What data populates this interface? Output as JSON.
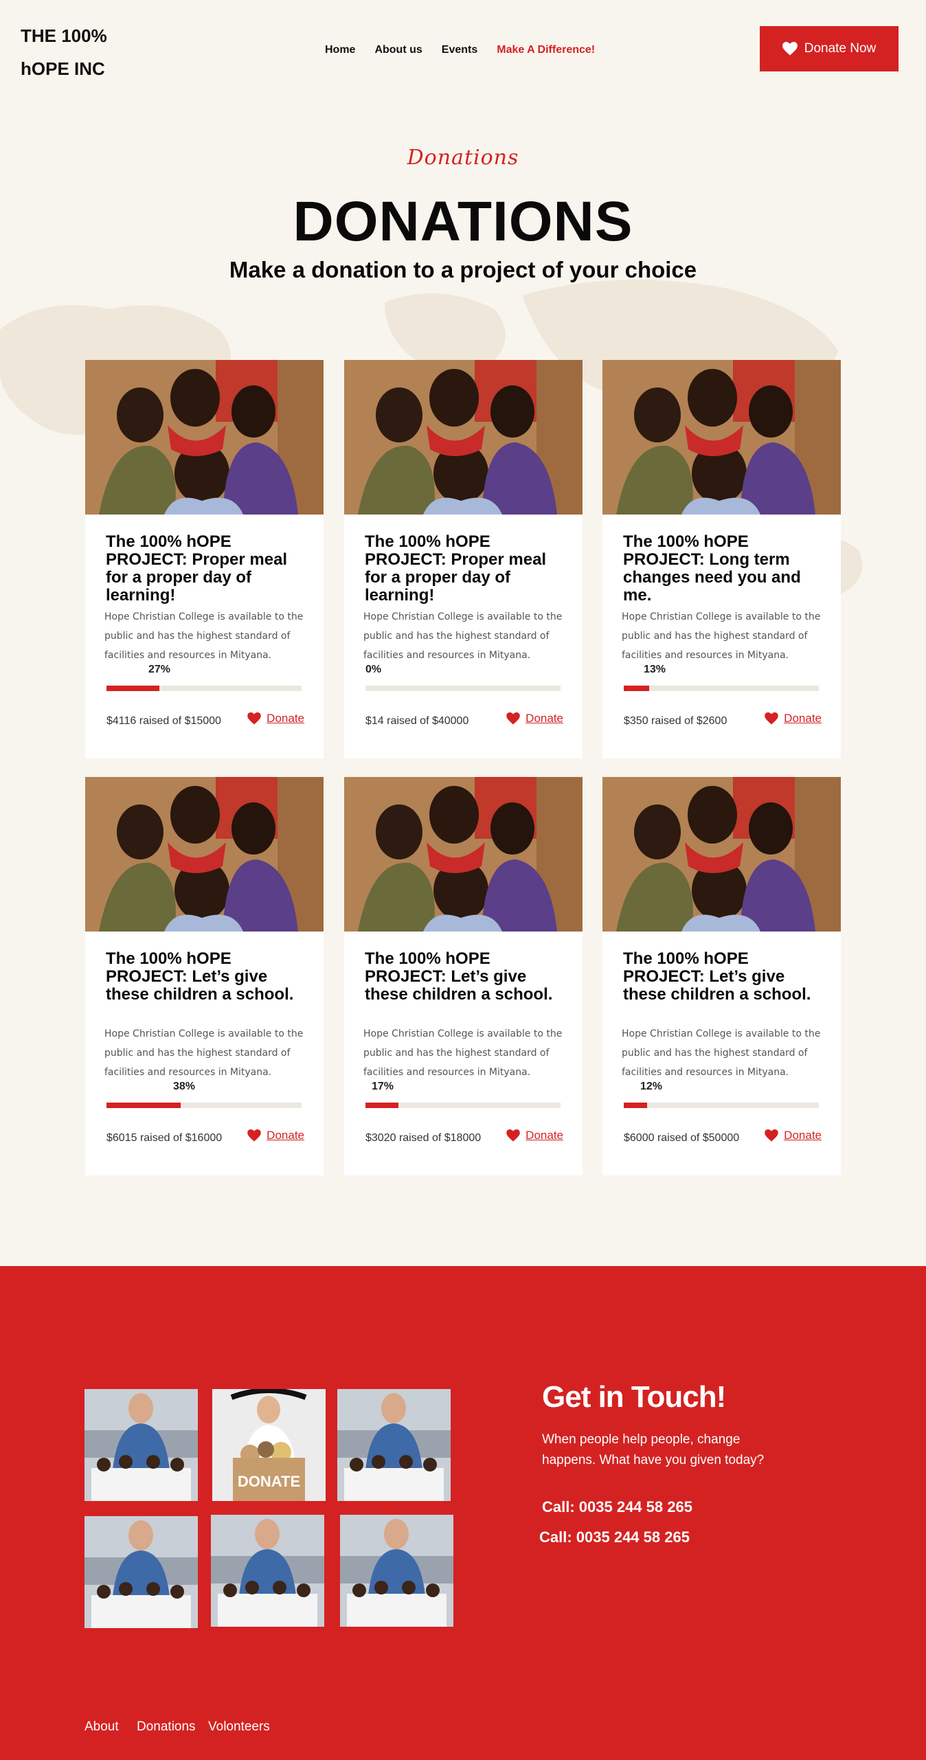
{
  "header": {
    "logo": "THE 100% hOPE INC",
    "nav": [
      "Home",
      "About us",
      "Events",
      "Make A Difference!"
    ],
    "active_nav": "Make A Difference!",
    "donate_button": "Donate Now"
  },
  "hero": {
    "script": "Donations",
    "title": "DONATIONS",
    "subtitle": "Make a donation to a project of your choice"
  },
  "projects": [
    {
      "title": "The 100% hOPE PROJECT: Proper meal for a proper day of learning!",
      "text": "Hope Christian College is available to the public and has the highest standard of facilities and resources in Mityana.",
      "percent_label": "27%",
      "progress": 0.27,
      "raised": "$4116 raised of $15000",
      "donate": "Donate"
    },
    {
      "title": "The 100% hOPE PROJECT: Proper meal for a proper day of learning!",
      "text": "Hope Christian College is available to the public and has the highest standard of facilities and resources in Mityana.",
      "percent_label": "0%",
      "progress": 0,
      "raised": "$14 raised of $40000",
      "donate": "Donate"
    },
    {
      "title": "The 100% hOPE PROJECT: Long term changes need you and me.",
      "text": "Hope Christian College is available to the public and has the highest standard of facilities and resources in Mityana.",
      "percent_label": "13%",
      "progress": 0.13,
      "raised": "$350 raised of $2600",
      "donate": "Donate"
    },
    {
      "title": "The 100% hOPE PROJECT: Let’s give these children a school.",
      "text": "Hope Christian College is available to the public and has the highest standard of facilities and resources in Mityana.",
      "percent_label": "38%",
      "progress": 0.38,
      "raised": "$6015 raised of $16000",
      "donate": "Donate"
    },
    {
      "title": "The 100% hOPE PROJECT: Let’s give these children a school.",
      "text": "Hope Christian College is available to the public and has the highest standard of facilities and resources in Mityana.",
      "percent_label": "17%",
      "progress": 0.17,
      "raised": "$3020 raised of $18000",
      "donate": "Donate"
    },
    {
      "title": "The 100% hOPE PROJECT: Let’s give these children a school.",
      "text": "Hope Christian College is available to the public and has the highest standard of facilities and resources in Mityana.",
      "percent_label": "12%",
      "progress": 0.12,
      "raised": "$6000 raised of $50000",
      "donate": "Donate"
    }
  ],
  "footer": {
    "title": "Get in Touch!",
    "text": "When people help people, change happens. What have you given today?",
    "calls": [
      "Call: 0035 244 58 265",
      "Call: 0035 244 58 265"
    ],
    "donate_box_text": "DONATE",
    "links": [
      "About",
      "Donations",
      "Volonteers"
    ]
  },
  "colors": {
    "accent": "#d42222",
    "background": "#f8f5ee",
    "card": "#ffffff"
  }
}
